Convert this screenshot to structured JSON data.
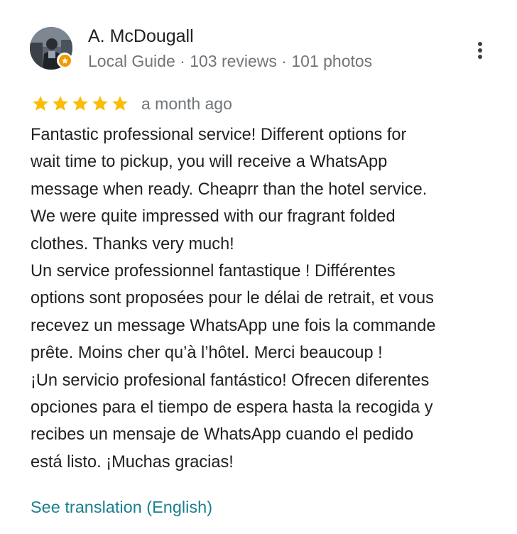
{
  "review": {
    "author": {
      "name": "A. McDougall",
      "meta": "Local Guide · 103 reviews · 101 photos",
      "avatar_icon": "profile-photo",
      "badge_icon": "local-guide-badge-icon",
      "badge_color": "#f29900"
    },
    "menu_icon": "more-vertical-icon",
    "rating": {
      "value": 5,
      "max": 5,
      "star_color": "#fbbc04"
    },
    "date": "a month ago",
    "text_lines": [
      "Fantastic professional service! Different options for",
      "wait time to pickup, you will receive a WhatsApp",
      "message when ready. Cheaprr than the hotel service.",
      "We were quite impressed with our fragrant folded",
      "clothes. Thanks very much!",
      "Un service professionnel fantastique ! Différentes",
      "options sont proposées pour le délai de retrait, et vous",
      "recevez un message WhatsApp une fois la commande",
      "prête. Moins cher qu’à l’hôtel. Merci beaucoup !",
      "¡Un servicio profesional fantástico! Ofrecen diferentes",
      "opciones para el tiempo de espera hasta la recogida y",
      "recibes un mensaje de WhatsApp cuando el pedido",
      "está listo. ¡Muchas gracias!"
    ],
    "translate_label": "See translation (English)",
    "link_color": "#1a7f8e"
  }
}
